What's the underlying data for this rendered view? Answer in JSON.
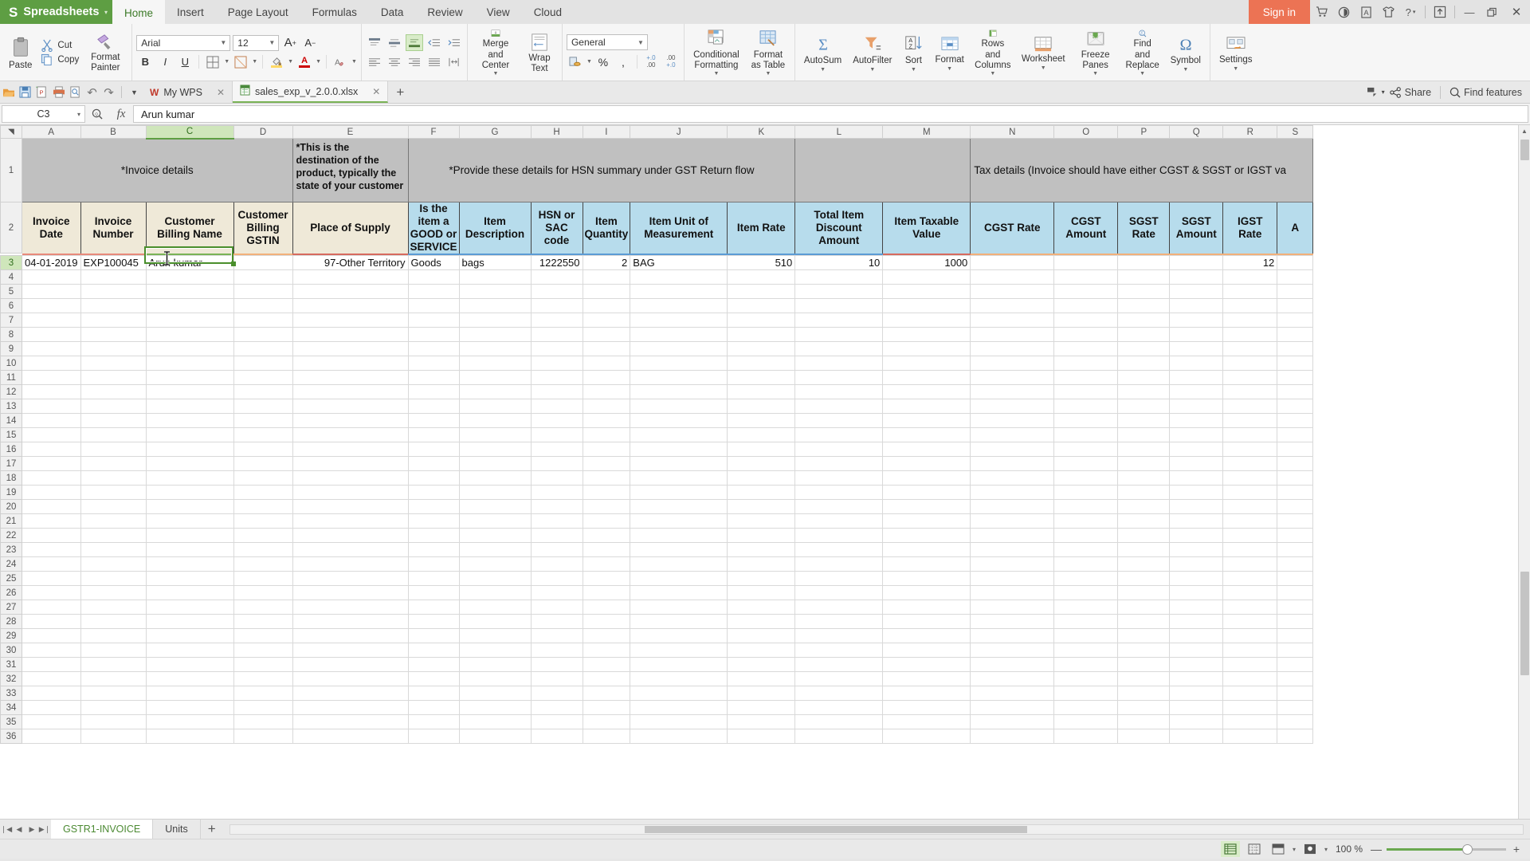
{
  "app": {
    "brand": "Spreadsheets",
    "brand_caret": "▾",
    "ribbon_tabs": [
      {
        "label": "Home",
        "active": true
      },
      {
        "label": "Insert",
        "active": false
      },
      {
        "label": "Page Layout",
        "active": false
      },
      {
        "label": "Formulas",
        "active": false
      },
      {
        "label": "Data",
        "active": false
      },
      {
        "label": "Review",
        "active": false
      },
      {
        "label": "View",
        "active": false
      },
      {
        "label": "Cloud",
        "active": false
      }
    ],
    "signin_label": "Sign in",
    "titlebar_icons": [
      {
        "name": "cart-icon",
        "glyph": "🛒"
      },
      {
        "name": "feedback-icon",
        "glyph": "◐"
      },
      {
        "name": "document-a-icon",
        "glyph": "Ⓐ"
      },
      {
        "name": "skin-icon",
        "glyph": "👕"
      },
      {
        "name": "help-icon",
        "glyph": "?"
      },
      {
        "name": "upload-icon",
        "glyph": "↑"
      },
      {
        "name": "minimize-icon",
        "glyph": "—"
      },
      {
        "name": "restore-icon",
        "glyph": "❐"
      },
      {
        "name": "close-icon",
        "glyph": "✕"
      }
    ]
  },
  "ribbon": {
    "clipboard": {
      "paste": "Paste",
      "cut": "Cut",
      "copy": "Copy",
      "format_painter": "Format Painter"
    },
    "font": {
      "family": "Arial",
      "size": "12",
      "grow_label": "A",
      "shrink_label": "A",
      "bold": "B",
      "italic": "I",
      "underline": "U"
    },
    "alignment": {
      "merge_center": "Merge and Center",
      "wrap_text": "Wrap Text"
    },
    "number": {
      "format": "General",
      "percent": "%",
      "comma": ",",
      "inc_dec": ".0",
      "dec_dec": ".00"
    },
    "styles": {
      "conditional_formatting": "Conditional Formatting",
      "format_as_table": "Format as Table"
    },
    "editing": {
      "autosum": "AutoSum",
      "autofilter": "AutoFilter",
      "sort": "Sort",
      "format": "Format",
      "rows_and_columns": "Rows and Columns",
      "worksheet": "Worksheet",
      "freeze_panes": "Freeze Panes",
      "find_and_replace": "Find and Replace",
      "symbol": "Symbol",
      "settings": "Settings"
    }
  },
  "quickbar": {
    "icons": [
      {
        "name": "open-icon",
        "glyph": "📂"
      },
      {
        "name": "save-icon",
        "glyph": "💾"
      },
      {
        "name": "save-as-pdf-icon",
        "glyph": "⎘"
      },
      {
        "name": "print-icon",
        "glyph": "⎙"
      },
      {
        "name": "print-preview-icon",
        "glyph": "▣"
      },
      {
        "name": "undo-icon",
        "glyph": "↶"
      },
      {
        "name": "redo-icon",
        "glyph": "↷"
      },
      {
        "name": "customize-icon",
        "glyph": "▾"
      }
    ],
    "tabs": [
      {
        "label": "My WPS",
        "active": false,
        "close": "✕"
      },
      {
        "label": "sales_exp_v_2.0.0.xlsx",
        "active": true,
        "close": "✕"
      }
    ],
    "new_tab": "+",
    "right": {
      "present": "⚑",
      "share": "Share",
      "find_features": "Find features"
    }
  },
  "formula_bar": {
    "name_box": "C3",
    "name_box_caret": "▾",
    "zoom_icon": "⌕",
    "fx": "fx",
    "value": "Arun kumar"
  },
  "sheet": {
    "columns": [
      "A",
      "B",
      "C",
      "D",
      "E",
      "F",
      "G",
      "H",
      "I",
      "J",
      "K",
      "L",
      "M",
      "N",
      "O",
      "P",
      "Q",
      "R",
      "S"
    ],
    "selected_column": "C",
    "selected_row": 3,
    "corner_glyph": "◥",
    "row_numbers": [
      1,
      2,
      3,
      4,
      5,
      6,
      7,
      8,
      9,
      10,
      11,
      12,
      13,
      14,
      15,
      16,
      17,
      18,
      19,
      20,
      21,
      22,
      23,
      24,
      25,
      26,
      27,
      28,
      29,
      30,
      31,
      32,
      33,
      34,
      35,
      36
    ],
    "group_headers": [
      {
        "label": "*Invoice details",
        "span_start": "A",
        "span_end": "D",
        "align": "center",
        "style": "plain"
      },
      {
        "label": "*This is the destination of the product, typically the state of your customer",
        "span_start": "E",
        "span_end": "E",
        "align": "left",
        "style": "note"
      },
      {
        "label": "*Provide these details for HSN summary under GST Return flow",
        "span_start": "F",
        "span_end": "K",
        "align": "center",
        "style": "plain"
      },
      {
        "label": "",
        "span_start": "L",
        "span_end": "M",
        "align": "center",
        "style": "plain"
      },
      {
        "label": "Tax details (Invoice should have either CGST & SGST or IGST va",
        "span_start": "N",
        "span_end": "S",
        "align": "left",
        "style": "lnote"
      }
    ],
    "column_headers": [
      {
        "col": "A",
        "label": "Invoice Date",
        "fill": "cream",
        "accent": "#e8897a"
      },
      {
        "col": "B",
        "label": "Invoice Number",
        "fill": "cream",
        "accent": "#e8897a"
      },
      {
        "col": "C",
        "label": "Customer Billing Name",
        "fill": "cream",
        "accent": "#7ab356"
      },
      {
        "col": "D",
        "label": "Customer Billing GSTIN",
        "fill": "cream",
        "accent": "#f2b07a"
      },
      {
        "col": "E",
        "label": "Place of Supply",
        "fill": "cream",
        "accent": "#d76a5e"
      },
      {
        "col": "F",
        "label": "Is the item a GOOD or SERVICE",
        "fill": "blue",
        "accent": "#5b9bd5"
      },
      {
        "col": "G",
        "label": "Item Description",
        "fill": "blue",
        "accent": "#5b9bd5"
      },
      {
        "col": "H",
        "label": "HSN or SAC code",
        "fill": "blue",
        "accent": "#5b9bd5"
      },
      {
        "col": "I",
        "label": "Item Quantity",
        "fill": "blue",
        "accent": "#5b9bd5"
      },
      {
        "col": "J",
        "label": "Item Unit of Measurement",
        "fill": "blue",
        "accent": "#5b9bd5"
      },
      {
        "col": "K",
        "label": "Item Rate",
        "fill": "blue",
        "accent": "#5b9bd5"
      },
      {
        "col": "L",
        "label": "Total Item Discount Amount",
        "fill": "blue",
        "accent": "#5b9bd5"
      },
      {
        "col": "M",
        "label": "Item Taxable Value",
        "fill": "blue",
        "accent": "#d76a5e"
      },
      {
        "col": "N",
        "label": "CGST Rate",
        "fill": "blue",
        "accent": "#f2b07a"
      },
      {
        "col": "O",
        "label": "CGST Amount",
        "fill": "blue",
        "accent": "#f2b07a"
      },
      {
        "col": "P",
        "label": "SGST Rate",
        "fill": "blue",
        "accent": "#f2b07a"
      },
      {
        "col": "Q",
        "label": "SGST Amount",
        "fill": "blue",
        "accent": "#f2b07a"
      },
      {
        "col": "R",
        "label": "IGST Rate",
        "fill": "blue",
        "accent": "#f2b07a"
      },
      {
        "col": "S",
        "label": "A",
        "fill": "blue",
        "accent": "#f2b07a"
      }
    ],
    "data_rows": [
      {
        "row": 3,
        "cells": {
          "A": {
            "value": "04-01-2019",
            "align": "left"
          },
          "B": {
            "value": "EXP100045",
            "align": "left"
          },
          "C": {
            "value": "Arun kumar",
            "align": "left"
          },
          "D": {
            "value": "",
            "align": "left"
          },
          "E": {
            "value": "97-Other Territory",
            "align": "right"
          },
          "F": {
            "value": "Goods",
            "align": "left"
          },
          "G": {
            "value": "bags",
            "align": "left"
          },
          "H": {
            "value": "1222550",
            "align": "right"
          },
          "I": {
            "value": "2",
            "align": "right"
          },
          "J": {
            "value": "BAG",
            "align": "left"
          },
          "K": {
            "value": "510",
            "align": "right"
          },
          "L": {
            "value": "10",
            "align": "right"
          },
          "M": {
            "value": "1000",
            "align": "right"
          },
          "N": {
            "value": "",
            "align": "right"
          },
          "O": {
            "value": "",
            "align": "right"
          },
          "P": {
            "value": "",
            "align": "right"
          },
          "Q": {
            "value": "",
            "align": "right"
          },
          "R": {
            "value": "12",
            "align": "right"
          },
          "S": {
            "value": "",
            "align": "right"
          }
        }
      }
    ]
  },
  "sheet_tabs": {
    "nav": [
      "❘◀",
      "◀",
      "▶",
      "▶❘"
    ],
    "tabs": [
      {
        "label": "GSTR1-INVOICE",
        "active": true
      },
      {
        "label": "Units",
        "active": false
      }
    ],
    "add": "+"
  },
  "status_bar": {
    "view_buttons": [
      {
        "name": "normal-view-icon",
        "glyph": "▤",
        "selected": true
      },
      {
        "name": "page-break-view-icon",
        "glyph": "▦",
        "selected": false
      },
      {
        "name": "page-layout-icon",
        "glyph": "▥",
        "selected": false
      },
      {
        "name": "reading-layout-icon",
        "glyph": "▣",
        "selected": false
      }
    ],
    "zoom_level": "100 %",
    "zoom_out": "—",
    "zoom_in": "+"
  },
  "colors": {
    "brand_green": "#5e9e43",
    "signin_orange": "#ec7354",
    "selection_green": "#4a8f2c",
    "header_cream": "#efe9d8",
    "header_blue": "#b7dcec",
    "group_gray": "#c0c0c0"
  }
}
